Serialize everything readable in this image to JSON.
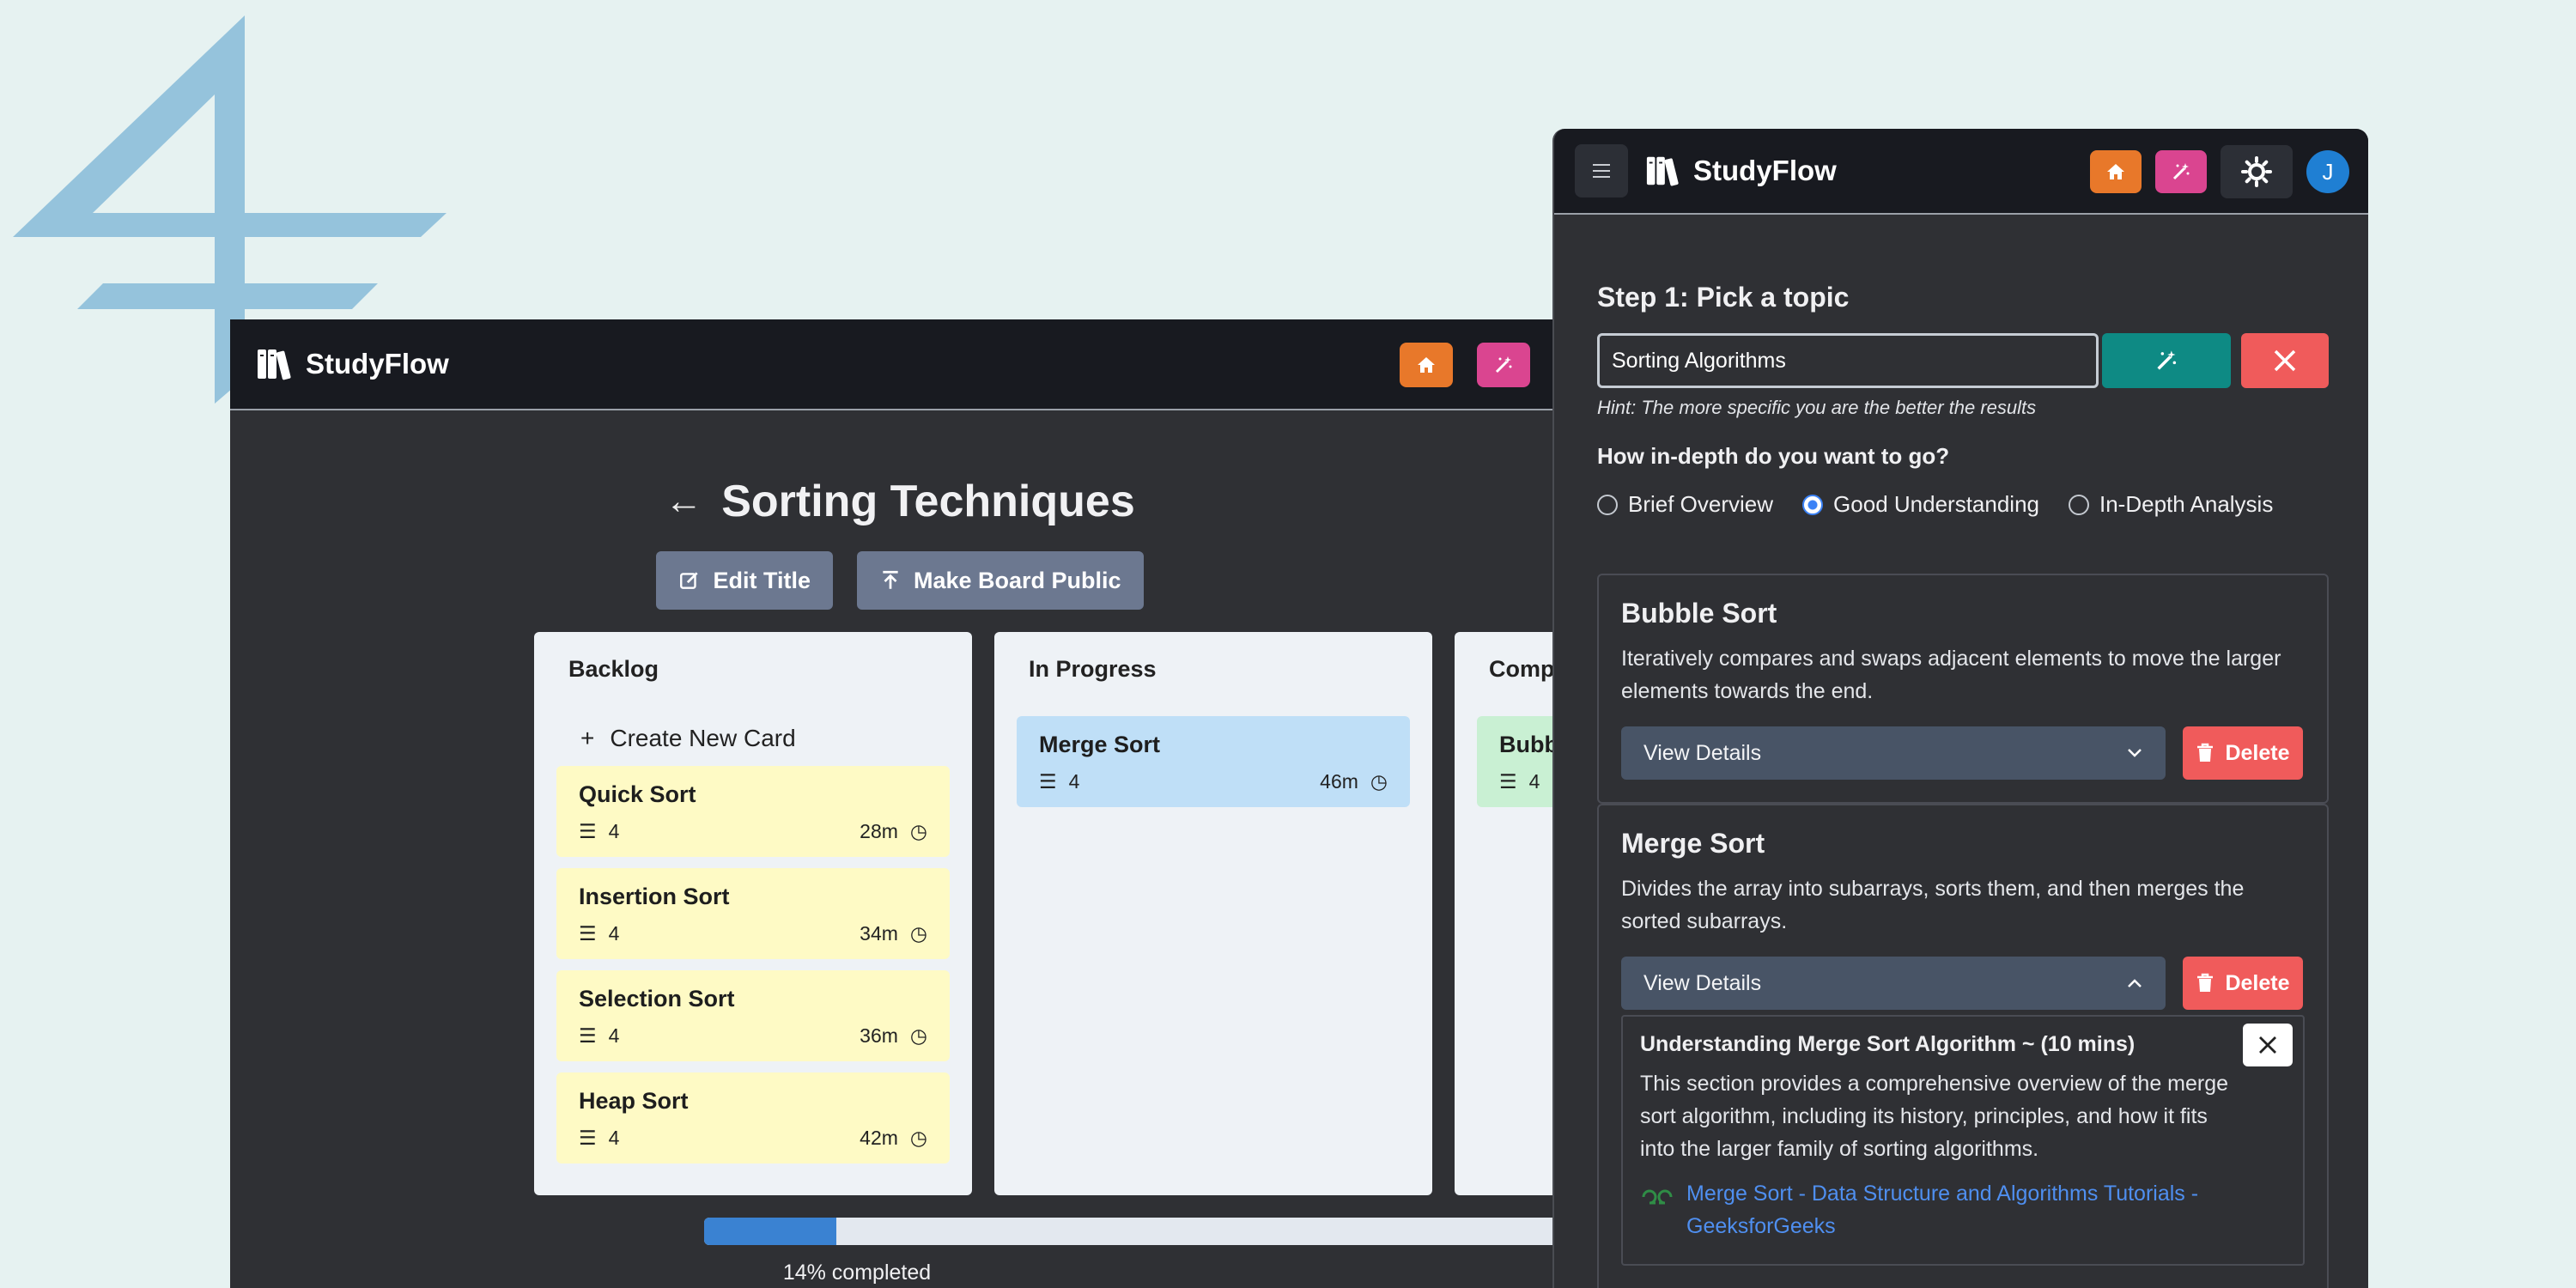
{
  "colors": {
    "background": "#e6f2f1",
    "nav_bg": "#181a20",
    "panel_bg": "#2f3034",
    "home_btn": "#e8782a",
    "magic_btn": "#da4590",
    "teal": "#0e8a84",
    "danger": "#f05b5b",
    "progress": "#3a82d2",
    "card_yellow": "#fefac5",
    "card_blue": "#bfdff7",
    "card_green": "#c9f0d3",
    "avatar": "#1f7fd3"
  },
  "back_window": {
    "brand": "StudyFlow",
    "board_title": "Sorting Techniques",
    "edit_title_label": "Edit Title",
    "make_public_label": "Make Board Public",
    "columns": [
      {
        "title": "Backlog",
        "create_label": "Create New Card",
        "cards": [
          {
            "title": "Quick Sort",
            "count": "4",
            "time": "28m"
          },
          {
            "title": "Insertion Sort",
            "count": "4",
            "time": "34m"
          },
          {
            "title": "Selection Sort",
            "count": "4",
            "time": "36m"
          },
          {
            "title": "Heap Sort",
            "count": "4",
            "time": "42m"
          }
        ]
      },
      {
        "title": "In Progress",
        "cards": [
          {
            "title": "Merge Sort",
            "count": "4",
            "time": "46m"
          }
        ]
      },
      {
        "title": "Comp",
        "cards": [
          {
            "title": "Bubb",
            "count": "4"
          }
        ]
      }
    ],
    "progress_fraction": 0.14,
    "progress_text": "14% completed"
  },
  "front_panel": {
    "brand": "StudyFlow",
    "avatar_initial": "J",
    "step_title": "Step 1: Pick a topic",
    "topic_value": "Sorting Algorithms",
    "hint": "Hint: The more specific you are the better the results",
    "depth_question": "How in-depth do you want to go?",
    "depth_options": [
      "Brief Overview",
      "Good Understanding",
      "In-Depth Analysis"
    ],
    "depth_selected": "Good Understanding",
    "topics": [
      {
        "title": "Bubble Sort",
        "description": "Iteratively compares and swaps adjacent elements to move the larger elements towards the end.",
        "view_label": "View Details",
        "delete_label": "Delete"
      },
      {
        "title": "Merge Sort",
        "description": "Divides the array into subarrays, sorts them, and then merges the sorted subarrays.",
        "view_label": "View Details",
        "delete_label": "Delete",
        "detail": {
          "title": "Understanding Merge Sort Algorithm ~ (10 mins)",
          "description": "This section provides a comprehensive overview of the merge sort algorithm, including its history, principles, and how it fits into the larger family of sorting algorithms.",
          "link_text": "Merge Sort - Data Structure and Algorithms Tutorials - GeeksforGeeks"
        }
      }
    ]
  }
}
